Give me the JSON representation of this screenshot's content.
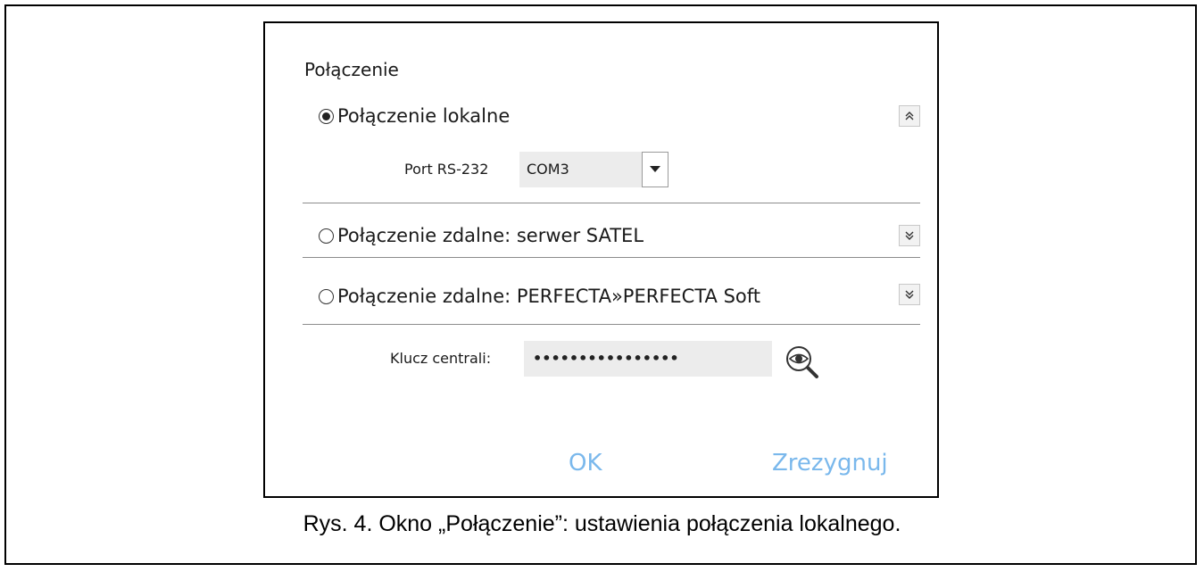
{
  "dialog": {
    "title": "Połączenie",
    "sections": [
      {
        "label": "Połączenie lokalne",
        "selected": true,
        "expanded": true,
        "toggle_icon": "chevrons-up-icon"
      },
      {
        "label": "Połączenie zdalne: serwer SATEL",
        "selected": false,
        "expanded": false,
        "toggle_icon": "chevrons-down-icon"
      },
      {
        "label": "Połączenie zdalne: PERFECTA»PERFECTA Soft",
        "selected": false,
        "expanded": false,
        "toggle_icon": "chevrons-down-icon"
      }
    ],
    "port": {
      "label": "Port RS-232",
      "value": "COM3"
    },
    "key": {
      "label": "Klucz centrali:",
      "value": "••••••••••••••••",
      "reveal_icon": "magnifier-eye-icon"
    },
    "ok_label": "OK",
    "cancel_label": "Zrezygnuj",
    "colors": {
      "button_text": "#7ab8ec",
      "field_background": "#ececec",
      "divider": "#8c8c8c"
    }
  },
  "caption": "Rys. 4. Okno „Połączenie”: ustawienia połączenia lokalnego."
}
